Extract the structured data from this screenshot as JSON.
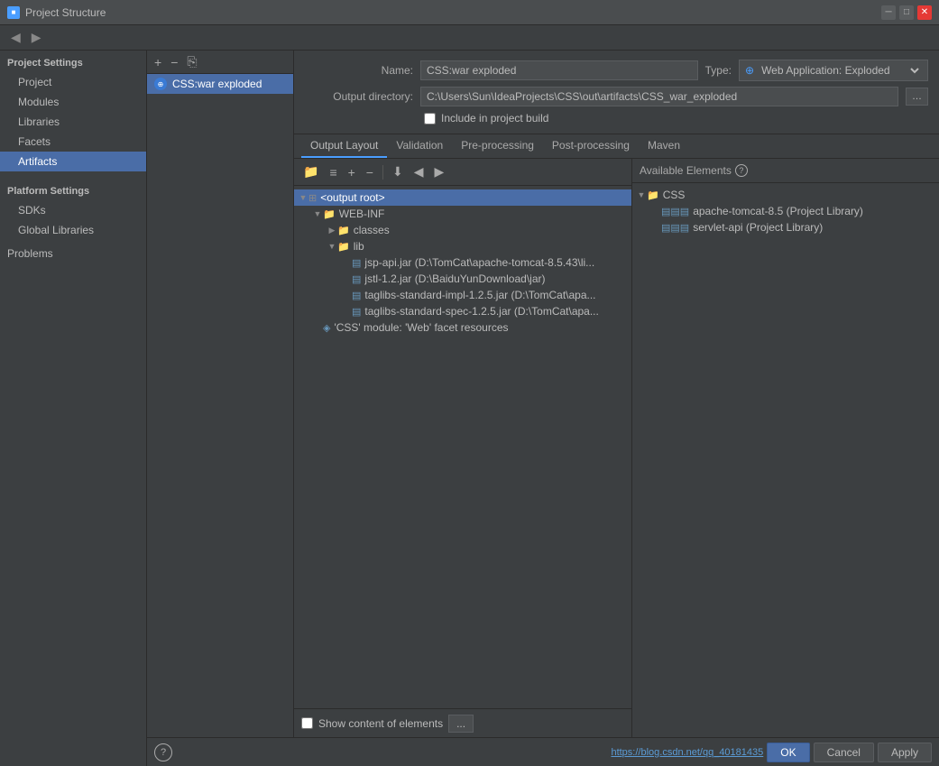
{
  "titleBar": {
    "icon": "■",
    "title": "Project Structure",
    "closeLabel": "✕",
    "minLabel": "─",
    "maxLabel": "□"
  },
  "navBar": {
    "backLabel": "◀",
    "forwardLabel": "▶"
  },
  "sidebar": {
    "projectSettingsHeader": "Project Settings",
    "items": [
      {
        "id": "project",
        "label": "Project"
      },
      {
        "id": "modules",
        "label": "Modules"
      },
      {
        "id": "libraries",
        "label": "Libraries"
      },
      {
        "id": "facets",
        "label": "Facets"
      },
      {
        "id": "artifacts",
        "label": "Artifacts",
        "active": true
      }
    ],
    "platformSettingsHeader": "Platform Settings",
    "platformItems": [
      {
        "id": "sdks",
        "label": "SDKs"
      },
      {
        "id": "global-libraries",
        "label": "Global Libraries"
      }
    ],
    "problemsLabel": "Problems"
  },
  "artifactList": {
    "items": [
      {
        "id": "css-war-exploded",
        "label": "CSS:war exploded",
        "selected": true
      }
    ]
  },
  "config": {
    "nameLabel": "Name:",
    "nameValue": "CSS:war exploded",
    "typeLabel": "Type:",
    "typeValue": "Web Application: Exploded",
    "outputDirLabel": "Output directory:",
    "outputDirValue": "C:\\Users\\Sun\\IdeaProjects\\CSS\\out\\artifacts\\CSS_war_exploded",
    "includeInBuildLabel": "Include in project build"
  },
  "tabs": [
    {
      "id": "output-layout",
      "label": "Output Layout",
      "active": true
    },
    {
      "id": "validation",
      "label": "Validation"
    },
    {
      "id": "pre-processing",
      "label": "Pre-processing"
    },
    {
      "id": "post-processing",
      "label": "Post-processing"
    },
    {
      "id": "maven",
      "label": "Maven"
    }
  ],
  "toolbar": {
    "addLabel": "+",
    "removeLabel": "−",
    "copyLabel": "⎘",
    "upLabel": "↑",
    "downLabel": "↓",
    "moveUpLabel": "↑",
    "moveDownLabel": "↓"
  },
  "treeItems": [
    {
      "id": "output-root",
      "label": "<output root>",
      "indent": 0,
      "selected": true,
      "type": "root",
      "expanded": true,
      "arrow": "▼"
    },
    {
      "id": "web-inf",
      "label": "WEB-INF",
      "indent": 1,
      "type": "folder",
      "expanded": true,
      "arrow": "▼"
    },
    {
      "id": "classes",
      "label": "classes",
      "indent": 2,
      "type": "folder",
      "expanded": false,
      "arrow": "▶"
    },
    {
      "id": "lib",
      "label": "lib",
      "indent": 2,
      "type": "folder",
      "expanded": true,
      "arrow": "▼"
    },
    {
      "id": "jsp-api-jar",
      "label": "jsp-api.jar (D:\\TomCat\\apache-tomcat-8.5.43\\li...",
      "indent": 3,
      "type": "jar"
    },
    {
      "id": "jstl-jar",
      "label": "jstl-1.2.jar (D:\\BaiduYunDownload\\jar)",
      "indent": 3,
      "type": "jar"
    },
    {
      "id": "taglibs-standard-impl-jar",
      "label": "taglibs-standard-impl-1.2.5.jar (D:\\TomCat\\apa...",
      "indent": 3,
      "type": "jar"
    },
    {
      "id": "taglibs-standard-spec-jar",
      "label": "taglibs-standard-spec-1.2.5.jar (D:\\TomCat\\apa...",
      "indent": 3,
      "type": "jar"
    },
    {
      "id": "css-module",
      "label": "'CSS' module: 'Web' facet resources",
      "indent": 1,
      "type": "module"
    }
  ],
  "availableElements": {
    "header": "Available Elements",
    "helpLabel": "?",
    "items": [
      {
        "id": "css-folder",
        "label": "CSS",
        "indent": 0,
        "type": "folder",
        "expanded": true,
        "arrow": "▼"
      },
      {
        "id": "apache-tomcat",
        "label": "apache-tomcat-8.5 (Project Library)",
        "indent": 1,
        "type": "lib"
      },
      {
        "id": "servlet-api",
        "label": "servlet-api (Project Library)",
        "indent": 1,
        "type": "lib"
      }
    ]
  },
  "bottomBar": {
    "showContentLabel": "Show content of elements",
    "moreLabel": "..."
  },
  "footer": {
    "helpLabel": "?",
    "okLabel": "OK",
    "cancelLabel": "Cancel",
    "applyLabel": "Apply",
    "url": "https://blog.csdn.net/qq_40181435"
  }
}
